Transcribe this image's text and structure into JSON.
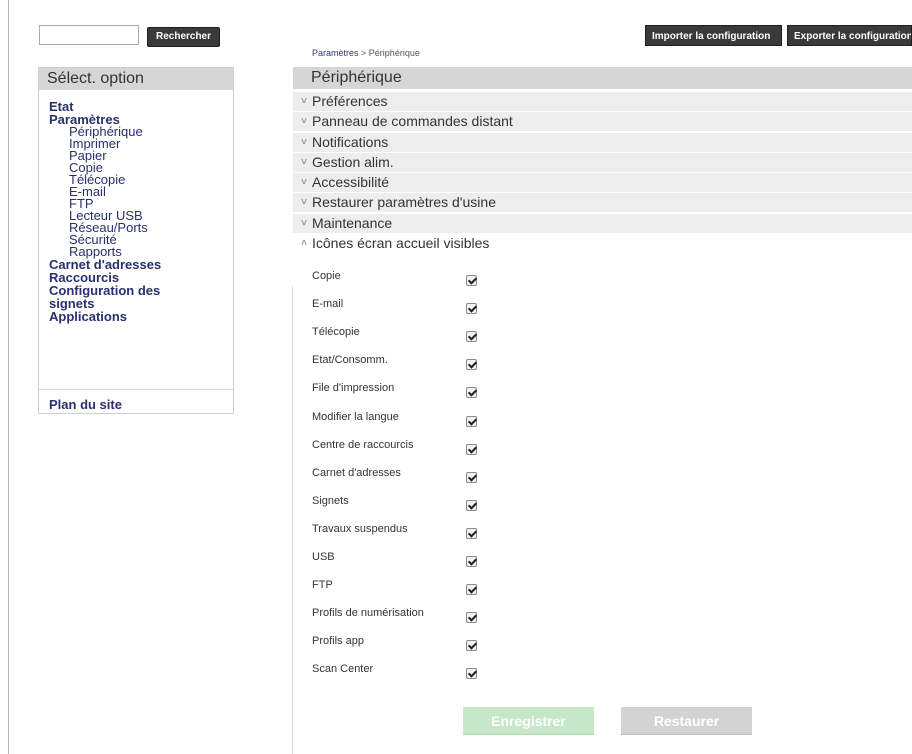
{
  "search": {
    "value": "",
    "button_label": "Rechercher"
  },
  "toolbar": {
    "import_label": "Importer la configuration",
    "export_label": "Exporter la configuration"
  },
  "breadcrumb": {
    "parent": "Paramètres",
    "separator": " > ",
    "current": "Périphérique"
  },
  "sidebar": {
    "title": "Sélect. option",
    "items": [
      {
        "label": "Etat",
        "level": 0
      },
      {
        "label": "Paramètres",
        "level": 0
      },
      {
        "label": "Périphérique",
        "level": 1
      },
      {
        "label": "Imprimer",
        "level": 1
      },
      {
        "label": "Papier",
        "level": 1
      },
      {
        "label": "Copie",
        "level": 1
      },
      {
        "label": "Télécopie",
        "level": 1
      },
      {
        "label": "E-mail",
        "level": 1
      },
      {
        "label": "FTP",
        "level": 1
      },
      {
        "label": "Lecteur USB",
        "level": 1
      },
      {
        "label": "Réseau/Ports",
        "level": 1
      },
      {
        "label": "Sécurité",
        "level": 1
      },
      {
        "label": "Rapports",
        "level": 1
      },
      {
        "label": "Carnet d'adresses",
        "level": 0
      },
      {
        "label": "Raccourcis",
        "level": 0
      },
      {
        "label": "Configuration des",
        "level": 0
      },
      {
        "label": "signets",
        "level": 0
      },
      {
        "label": "Applications",
        "level": 0
      }
    ],
    "sitemap_label": "Plan du site"
  },
  "main": {
    "title": "Périphérique",
    "sections": [
      {
        "label": "Préférences",
        "expanded": false,
        "icon": "chevron-down-icon"
      },
      {
        "label": "Panneau de commandes distant",
        "expanded": false,
        "icon": "chevron-down-icon"
      },
      {
        "label": "Notifications",
        "expanded": false,
        "icon": "chevron-down-icon"
      },
      {
        "label": "Gestion alim.",
        "expanded": false,
        "icon": "chevron-down-icon"
      },
      {
        "label": "Accessibilité",
        "expanded": false,
        "icon": "chevron-down-icon"
      },
      {
        "label": "Restaurer paramètres d'usine",
        "expanded": false,
        "icon": "chevron-down-icon"
      },
      {
        "label": "Maintenance",
        "expanded": false,
        "icon": "chevron-down-icon"
      },
      {
        "label": "Icônes écran accueil visibles",
        "expanded": true,
        "icon": "chevron-up-icon"
      }
    ],
    "home_icons": [
      {
        "label": "Copie",
        "checked": true
      },
      {
        "label": "E-mail",
        "checked": true
      },
      {
        "label": "Télécopie",
        "checked": true
      },
      {
        "label": "Etat/Consomm.",
        "checked": true
      },
      {
        "label": "File d'impression",
        "checked": true
      },
      {
        "label": "Modifier la langue",
        "checked": true
      },
      {
        "label": "Centre de raccourcis",
        "checked": true
      },
      {
        "label": "Carnet d'adresses",
        "checked": true
      },
      {
        "label": "Signets",
        "checked": true
      },
      {
        "label": "Travaux suspendus",
        "checked": true
      },
      {
        "label": "USB",
        "checked": true
      },
      {
        "label": "FTP",
        "checked": true
      },
      {
        "label": "Profils de numérisation",
        "checked": true
      },
      {
        "label": "Profils app",
        "checked": true
      },
      {
        "label": "Scan Center",
        "checked": true
      }
    ],
    "save_label": "Enregistrer",
    "restore_label": "Restaurer"
  },
  "colors": {
    "button_dark": "#3a3a3a",
    "link": "#2a2f6e",
    "header_gray": "#d6d6d6",
    "section_gray": "#ededed",
    "save_green": "#c6e7c8",
    "restore_gray": "#d3d3d3"
  }
}
